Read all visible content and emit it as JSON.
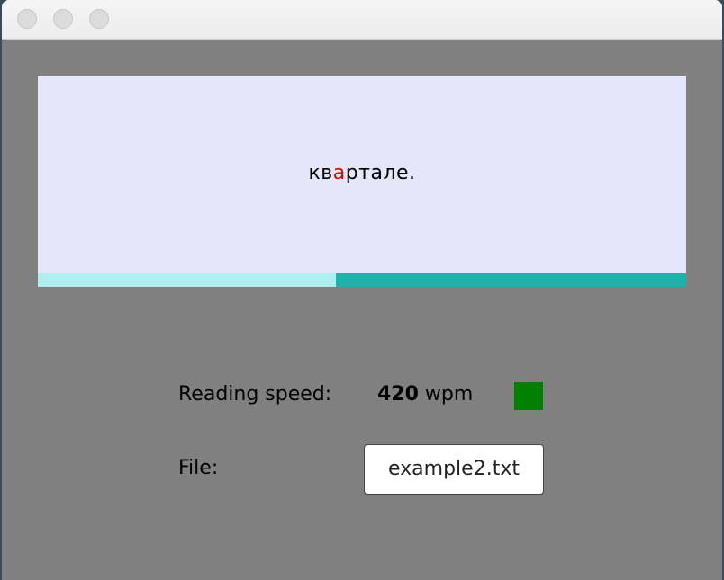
{
  "window": {
    "buttons": [
      "close",
      "minimize",
      "maximize"
    ]
  },
  "reader": {
    "word_pre": "кв",
    "word_focus": "а",
    "word_post": "ртале.",
    "focus_color": "#e00000",
    "background_color": "#e6e6fa"
  },
  "progress": {
    "fraction": 0.46,
    "fill_color": "#afeeee",
    "track_color": "#20b2aa"
  },
  "speed": {
    "label": "Reading speed:",
    "value": "420",
    "unit": " wpm",
    "status_color": "#008000"
  },
  "file": {
    "label": "File:",
    "name": "example2.txt"
  }
}
